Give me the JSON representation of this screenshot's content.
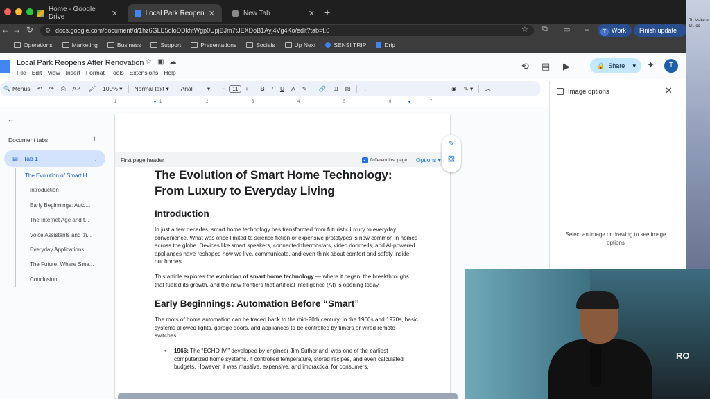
{
  "browser": {
    "tabs": [
      {
        "title": "Home - Google Drive",
        "active": false
      },
      {
        "title": "Local Park Reopens After Re",
        "active": true
      },
      {
        "title": "New Tab",
        "active": false
      }
    ],
    "url": "docs.google.com/document/d/1hz6GLE5dloDDkhtWgp0UpjBJm7tJEXDoB1Ayj4Vg4Ko/edit?tab=t.0",
    "profile_label": "Work",
    "profile_initial": "T",
    "update_label": "Finish update",
    "bookmarks": [
      "Operations",
      "Marketing",
      "Business",
      "Support",
      "Presentations",
      "Socials",
      "Up Next",
      "SENSI TRIP",
      "Drip"
    ]
  },
  "docs": {
    "title": "Local Park Reopens After Renovation",
    "menus": [
      "File",
      "Edit",
      "View",
      "Insert",
      "Format",
      "Tools",
      "Extensions",
      "Help"
    ],
    "share_label": "Share",
    "avatar_initial": "T",
    "toolbar": {
      "menus_label": "Menus",
      "zoom": "100%",
      "style": "Normal text",
      "font": "Arial",
      "font_size": "11"
    },
    "ruler": [
      "1",
      "1",
      "2",
      "3",
      "4",
      "5",
      "6",
      "7"
    ]
  },
  "left_panel": {
    "title": "Document tabs",
    "tab_label": "Tab 1",
    "outline": [
      "The Evolution of Smart H...",
      "Introduction",
      "Early Beginnings: Auto...",
      "The Internet Age and t...",
      "Voice Assistants and th...",
      "Everyday Applications ...",
      "The Future: Where Sma...",
      "Conclusion"
    ]
  },
  "page": {
    "header_label": "First page header",
    "different_first_page": "Different first page",
    "options_label": "Options",
    "h1": "The Evolution of Smart Home Technology: From Luxury to Everyday Living",
    "h2_intro": "Introduction",
    "p1": "In just a few decades, smart home technology has transformed from futuristic luxury to everyday convenience. What was once limited to science fiction or expensive prototypes is now common in homes across the globe. Devices like smart speakers, connected thermostats, video doorbells, and AI-powered appliances have reshaped how we live, communicate, and even think about comfort and safety inside our homes.",
    "p2_before": "This article explores the ",
    "p2_bold": "evolution of smart home technology",
    "p2_after": " — where it began, the breakthroughs that fueled its growth, and the new frontiers that artificial intelligence (AI) is opening today.",
    "h2_early": "Early Beginnings: Automation Before “Smart”",
    "p3": "The roots of home automation can be traced back to the mid-20th century. In the 1960s and 1970s, basic systems allowed lights, garage doors, and appliances to be controlled by timers or wired remote switches.",
    "li1_bold": "1966:",
    "li1_text": " The “ECHO IV,” developed by engineer Jim Sutherland, was one of the earliest computerized home systems. It controlled temperature, stored recipes, and even calculated budgets. However, it was massive, expensive, and impractical for consumers."
  },
  "right_panel": {
    "title": "Image options",
    "message": "Select an image or drawing to see image options"
  },
  "desktop": {
    "text": "To Make er D...oc"
  },
  "webcam": {
    "mic_text": "RO"
  }
}
